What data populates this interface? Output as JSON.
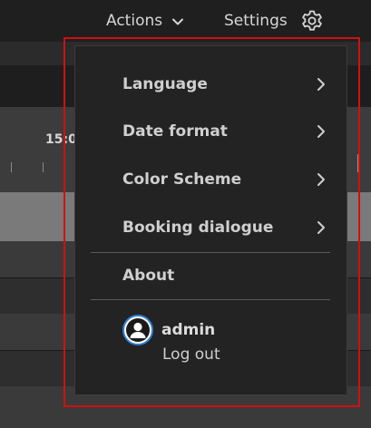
{
  "topbar": {
    "actions_label": "Actions",
    "actions_icon": "chevron-down-icon",
    "settings_label": "Settings",
    "settings_icon": "gear-icon"
  },
  "background": {
    "time_label": "15:0"
  },
  "menu": {
    "items": [
      {
        "label": "Language",
        "icon": "chevron-right-icon"
      },
      {
        "label": "Date format",
        "icon": "chevron-right-icon"
      },
      {
        "label": "Color Scheme",
        "icon": "chevron-right-icon"
      },
      {
        "label": "Booking dialogue",
        "icon": "chevron-right-icon"
      }
    ],
    "about_label": "About",
    "user": {
      "name": "admin",
      "avatar_icon": "user-avatar-icon",
      "avatar_ring_color": "#2f7fd8"
    },
    "logout_label": "Log out"
  },
  "colors": {
    "highlight_outline": "#d01010",
    "menu_background": "#232323",
    "topbar_background": "#1f1f1f"
  }
}
